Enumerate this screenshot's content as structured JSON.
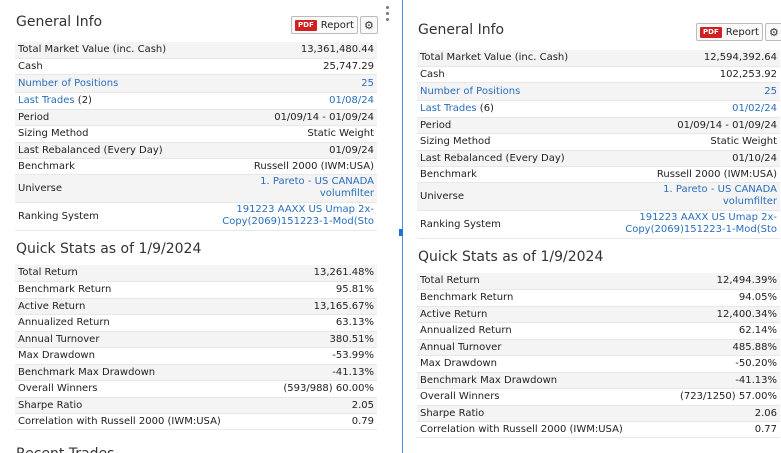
{
  "left": {
    "general_title": "General Info",
    "report_label": "Report",
    "pdf_label": "PDF",
    "general_rows": [
      {
        "label": "Total Market Value (inc. Cash)",
        "value": "13,361,480.44"
      },
      {
        "label": "Cash",
        "value": "25,747.29"
      },
      {
        "label": "Number of Positions",
        "value": "25"
      },
      {
        "label": "Last Trades",
        "label_count": "(2)",
        "value": "01/08/24"
      },
      {
        "label": "Period",
        "value": "01/09/14 - 01/09/24"
      },
      {
        "label": "Sizing Method",
        "value": "Static Weight"
      },
      {
        "label": "Last Rebalanced (Every Day)",
        "value": "01/09/24"
      },
      {
        "label": "Benchmark",
        "value": "Russell 2000 (IWM:USA)"
      },
      {
        "label": "Universe",
        "value_line1": "1. Pareto - US CANADA",
        "value_line2": "volumfilter"
      },
      {
        "label": "Ranking System",
        "value_line1": "191223 AAXX US Umap 2x-",
        "value_line2": "Copy(2069)151223-1-Mod(Sto"
      }
    ],
    "quick_title": "Quick Stats as of 1/9/2024",
    "quick_rows": [
      {
        "label": "Total Return",
        "value": "13,261.48%"
      },
      {
        "label": "Benchmark Return",
        "value": "95.81%"
      },
      {
        "label": "Active Return",
        "value": "13,165.67%"
      },
      {
        "label": "Annualized Return",
        "value": "63.13%"
      },
      {
        "label": "Annual Turnover",
        "value": "380.51%"
      },
      {
        "label": "Max Drawdown",
        "value": "-53.99%"
      },
      {
        "label": "Benchmark Max Drawdown",
        "value": "-41.13%"
      },
      {
        "label": "Overall Winners",
        "value": "(593/988) 60.00%"
      },
      {
        "label": "Sharpe Ratio",
        "value": "2.05"
      },
      {
        "label": "Correlation with Russell 2000 (IWM:USA)",
        "value": "0.79"
      }
    ],
    "recent_title": "Recent Trades"
  },
  "right": {
    "general_title": "General Info",
    "report_label": "Report",
    "pdf_label": "PDF",
    "general_rows": [
      {
        "label": "Total Market Value (inc. Cash)",
        "value": "12,594,392.64"
      },
      {
        "label": "Cash",
        "value": "102,253.92"
      },
      {
        "label": "Number of Positions",
        "value": "25"
      },
      {
        "label": "Last Trades",
        "label_count": "(6)",
        "value": "01/02/24"
      },
      {
        "label": "Period",
        "value": "01/09/14 - 01/09/24"
      },
      {
        "label": "Sizing Method",
        "value": "Static Weight"
      },
      {
        "label": "Last Rebalanced (Every Day)",
        "value": "01/10/24"
      },
      {
        "label": "Benchmark",
        "value": "Russell 2000 (IWM:USA)"
      },
      {
        "label": "Universe",
        "value_line1": "1. Pareto - US CANADA",
        "value_line2": "volumfilter"
      },
      {
        "label": "Ranking System",
        "value_line1": "191223 AAXX US Umap 2x-",
        "value_line2": "Copy(2069)151223-1-Mod(Sto"
      }
    ],
    "quick_title": "Quick Stats as of 1/9/2024",
    "quick_rows": [
      {
        "label": "Total Return",
        "value": "12,494.39%"
      },
      {
        "label": "Benchmark Return",
        "value": "94.05%"
      },
      {
        "label": "Active Return",
        "value": "12,400.34%"
      },
      {
        "label": "Annualized Return",
        "value": "62.14%"
      },
      {
        "label": "Annual Turnover",
        "value": "485.88%"
      },
      {
        "label": "Max Drawdown",
        "value": "-50.20%"
      },
      {
        "label": "Benchmark Max Drawdown",
        "value": "-41.13%"
      },
      {
        "label": "Overall Winners",
        "value": "(723/1250) 57.00%"
      },
      {
        "label": "Sharpe Ratio",
        "value": "2.06"
      },
      {
        "label": "Correlation with Russell 2000 (IWM:USA)",
        "value": "0.77"
      }
    ]
  },
  "colors": {
    "link": "#2a6ebb",
    "negative": "#c62828",
    "pdf": "#d21f1f",
    "divider": "#4a90d9"
  },
  "icons": {
    "pdf": "pdf-icon",
    "gear": "gear-icon",
    "grip": "drag-grip-icon"
  }
}
